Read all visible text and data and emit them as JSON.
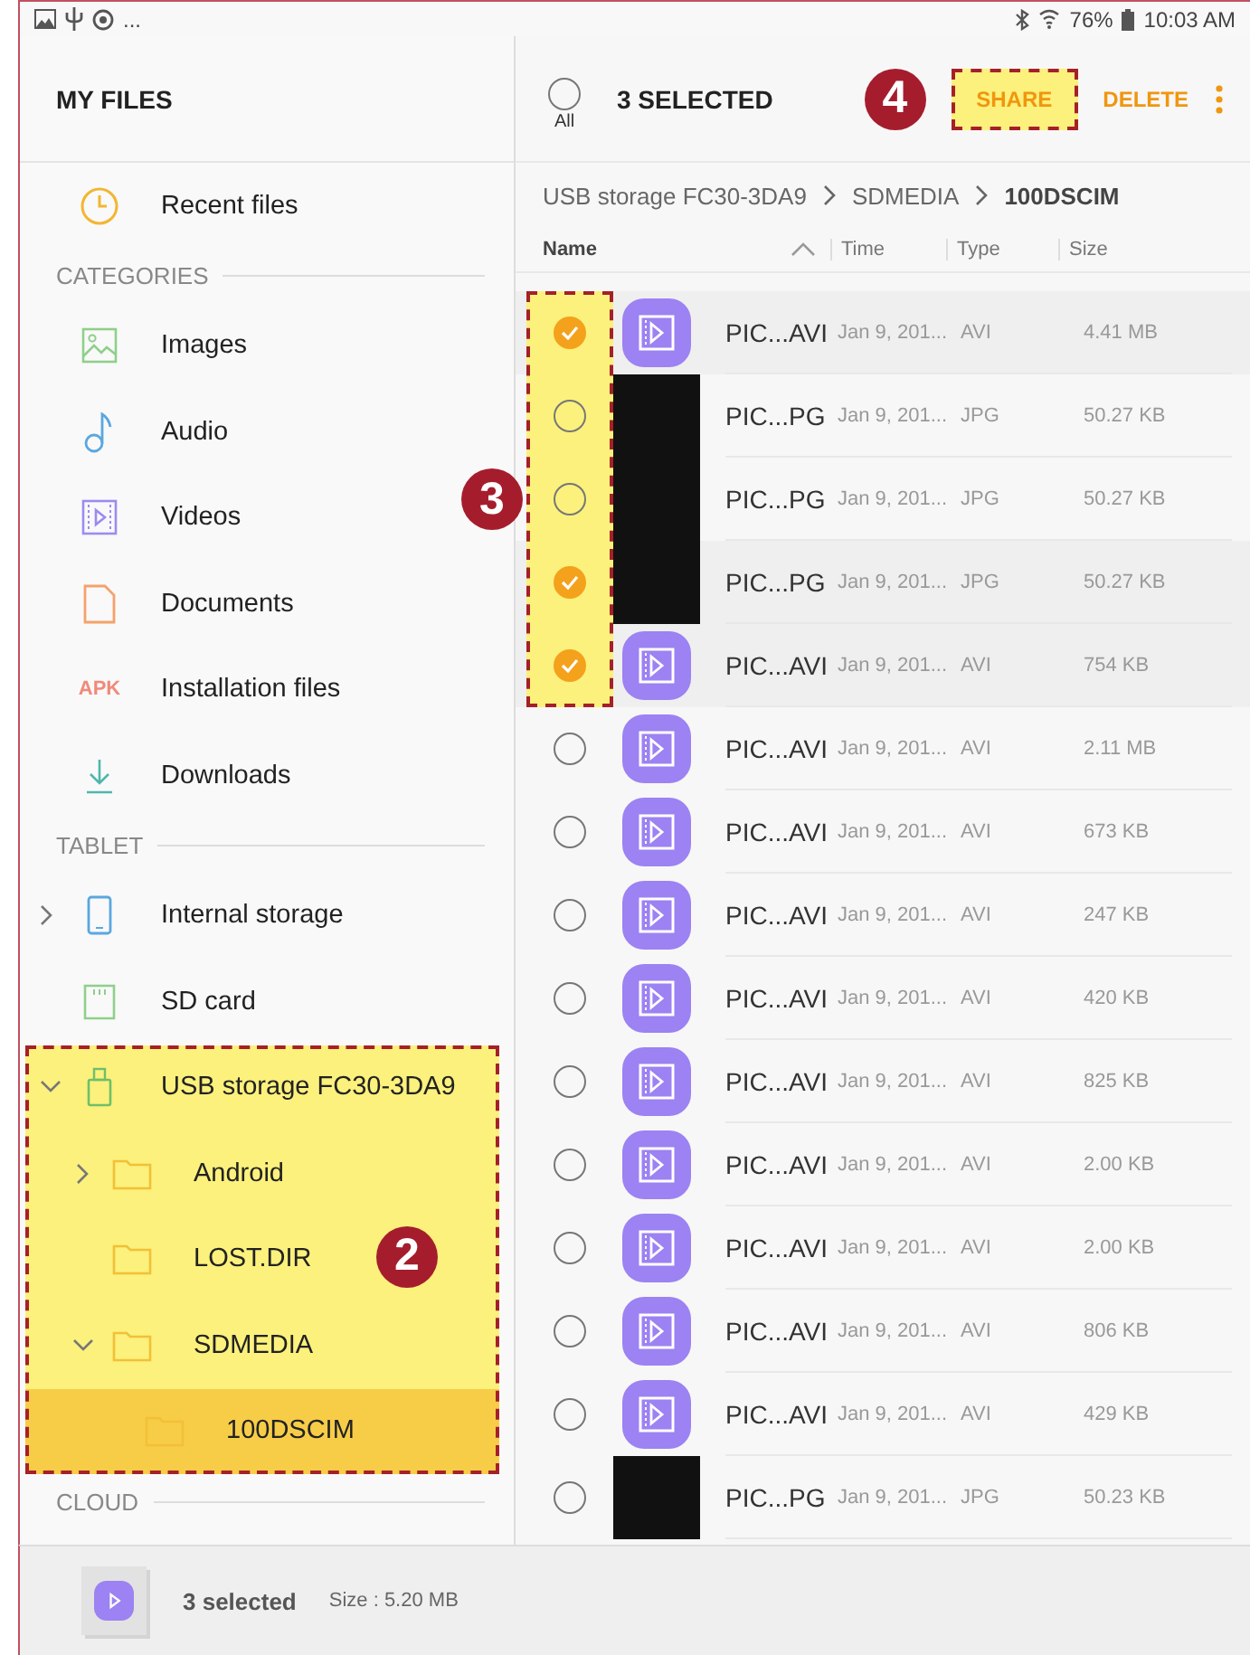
{
  "status_bar": {
    "more": "...",
    "battery": "76%",
    "time": "10:03 AM"
  },
  "sidebar": {
    "title": "MY FILES",
    "sections": [
      {
        "items": [
          {
            "label": "Recent files",
            "kind": "clock",
            "selected": false
          }
        ]
      },
      {
        "heading": "CATEGORIES",
        "items": [
          {
            "label": "Images",
            "kind": "image",
            "selected": false
          },
          {
            "label": "Audio",
            "kind": "music",
            "selected": false
          },
          {
            "label": "Videos",
            "kind": "video",
            "selected": false
          },
          {
            "label": "Documents",
            "kind": "document",
            "selected": false
          },
          {
            "label": "Installation files",
            "kind": "apk",
            "icon_text": "APK",
            "selected": false
          },
          {
            "label": "Downloads",
            "kind": "download",
            "selected": false
          }
        ]
      },
      {
        "heading": "TABLET",
        "items": [
          {
            "label": "Internal storage",
            "kind": "phone",
            "expanded": false,
            "selected": false,
            "highlighted": false
          },
          {
            "label": "SD card",
            "kind": "sdcard",
            "selected": false,
            "highlighted": false
          },
          {
            "label": "USB storage FC30-3DA9",
            "kind": "usb",
            "expanded": true,
            "selected": false,
            "highlighted": true,
            "children": [
              {
                "label": "Android",
                "kind": "folder",
                "expanded": false,
                "selected": false
              },
              {
                "label": "LOST.DIR",
                "kind": "folder",
                "selected": false
              },
              {
                "label": "SDMEDIA",
                "kind": "folder",
                "expanded": true,
                "selected": false,
                "children": [
                  {
                    "label": "100DSCIM",
                    "kind": "folder",
                    "selected": true
                  }
                ]
              }
            ]
          }
        ]
      },
      {
        "heading": "CLOUD"
      }
    ]
  },
  "toolbar": {
    "all_label": "All",
    "all_checked": false,
    "title": "3 SELECTED",
    "actions": [
      {
        "label": "SHARE",
        "highlighted": true
      },
      {
        "label": "DELETE",
        "highlighted": false
      }
    ]
  },
  "breadcrumb": [
    "USB storage FC30-3DA9",
    "SDMEDIA",
    "100DSCIM"
  ],
  "table": {
    "columns": [
      "Name",
      "Time",
      "Type",
      "Size"
    ],
    "rows": [
      {
        "name": "PIC...AVI",
        "time": "Jan 9, 201...",
        "type": "AVI",
        "size": "4.41 MB",
        "kind": "video",
        "checked": true,
        "highlighted": true
      },
      {
        "name": "PIC...PG",
        "time": "Jan 9, 201...",
        "type": "JPG",
        "size": "50.27 KB",
        "kind": "photo",
        "checked": false,
        "highlighted": true
      },
      {
        "name": "PIC...PG",
        "time": "Jan 9, 201...",
        "type": "JPG",
        "size": "50.27 KB",
        "kind": "photo",
        "checked": false,
        "highlighted": true
      },
      {
        "name": "PIC...PG",
        "time": "Jan 9, 201...",
        "type": "JPG",
        "size": "50.27 KB",
        "kind": "photo",
        "checked": true,
        "highlighted": true
      },
      {
        "name": "PIC...AVI",
        "time": "Jan 9, 201...",
        "type": "AVI",
        "size": "754 KB",
        "kind": "video",
        "checked": true,
        "highlighted": true
      },
      {
        "name": "PIC...AVI",
        "time": "Jan 9, 201...",
        "type": "AVI",
        "size": "2.11 MB",
        "kind": "video",
        "checked": false,
        "highlighted": false
      },
      {
        "name": "PIC...AVI",
        "time": "Jan 9, 201...",
        "type": "AVI",
        "size": "673 KB",
        "kind": "video",
        "checked": false,
        "highlighted": false
      },
      {
        "name": "PIC...AVI",
        "time": "Jan 9, 201...",
        "type": "AVI",
        "size": "247 KB",
        "kind": "video",
        "checked": false,
        "highlighted": false
      },
      {
        "name": "PIC...AVI",
        "time": "Jan 9, 201...",
        "type": "AVI",
        "size": "420 KB",
        "kind": "video",
        "checked": false,
        "highlighted": false
      },
      {
        "name": "PIC...AVI",
        "time": "Jan 9, 201...",
        "type": "AVI",
        "size": "825 KB",
        "kind": "video",
        "checked": false,
        "highlighted": false
      },
      {
        "name": "PIC...AVI",
        "time": "Jan 9, 201...",
        "type": "AVI",
        "size": "2.00 KB",
        "kind": "video",
        "checked": false,
        "highlighted": false
      },
      {
        "name": "PIC...AVI",
        "time": "Jan 9, 201...",
        "type": "AVI",
        "size": "2.00 KB",
        "kind": "video",
        "checked": false,
        "highlighted": false
      },
      {
        "name": "PIC...AVI",
        "time": "Jan 9, 201...",
        "type": "AVI",
        "size": "806 KB",
        "kind": "video",
        "checked": false,
        "highlighted": false
      },
      {
        "name": "PIC...AVI",
        "time": "Jan 9, 201...",
        "type": "AVI",
        "size": "429 KB",
        "kind": "video",
        "checked": false,
        "highlighted": false
      },
      {
        "name": "PIC...PG",
        "time": "Jan 9, 201...",
        "type": "JPG",
        "size": "50.23 KB",
        "kind": "photo",
        "checked": false,
        "highlighted": false
      }
    ]
  },
  "bottom_bar": {
    "count": "3 selected",
    "size": "Size : 5.20 MB"
  },
  "callouts": [
    {
      "number": "2",
      "kind": "tree"
    },
    {
      "number": "3",
      "kind": "checkboxes"
    },
    {
      "number": "4",
      "kind": "share"
    }
  ]
}
